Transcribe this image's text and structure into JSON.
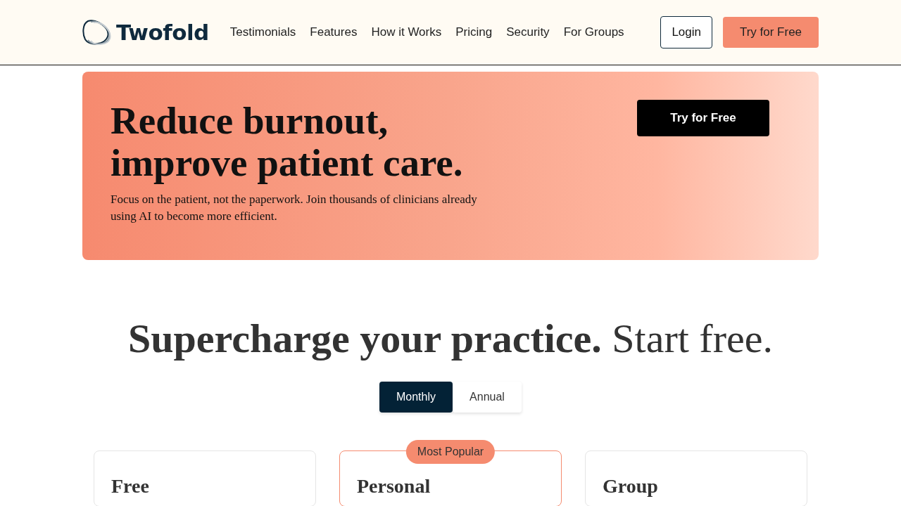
{
  "header": {
    "logo": "Twofold",
    "nav": [
      "Testimonials",
      "Features",
      "How it Works",
      "Pricing",
      "Security",
      "For Groups"
    ],
    "login": "Login",
    "cta": "Try for Free"
  },
  "hero": {
    "title": "Reduce burnout, improve patient care.",
    "subtitle": "Focus on the patient, not the paperwork. Join thousands of clinicians already using AI to become more efficient.",
    "cta": "Try for Free"
  },
  "pricing": {
    "heading": "**Supercharge your practice.** Start free.",
    "billing": [
      {
        "label": "Monthly",
        "selected": true
      },
      {
        "label": "Annual",
        "selected": false
      }
    ],
    "plans": [
      {
        "name": "Free",
        "featured": false
      },
      {
        "name": "Personal",
        "featured": true,
        "badge": "Most Popular"
      },
      {
        "name": "Group",
        "featured": false
      }
    ]
  }
}
